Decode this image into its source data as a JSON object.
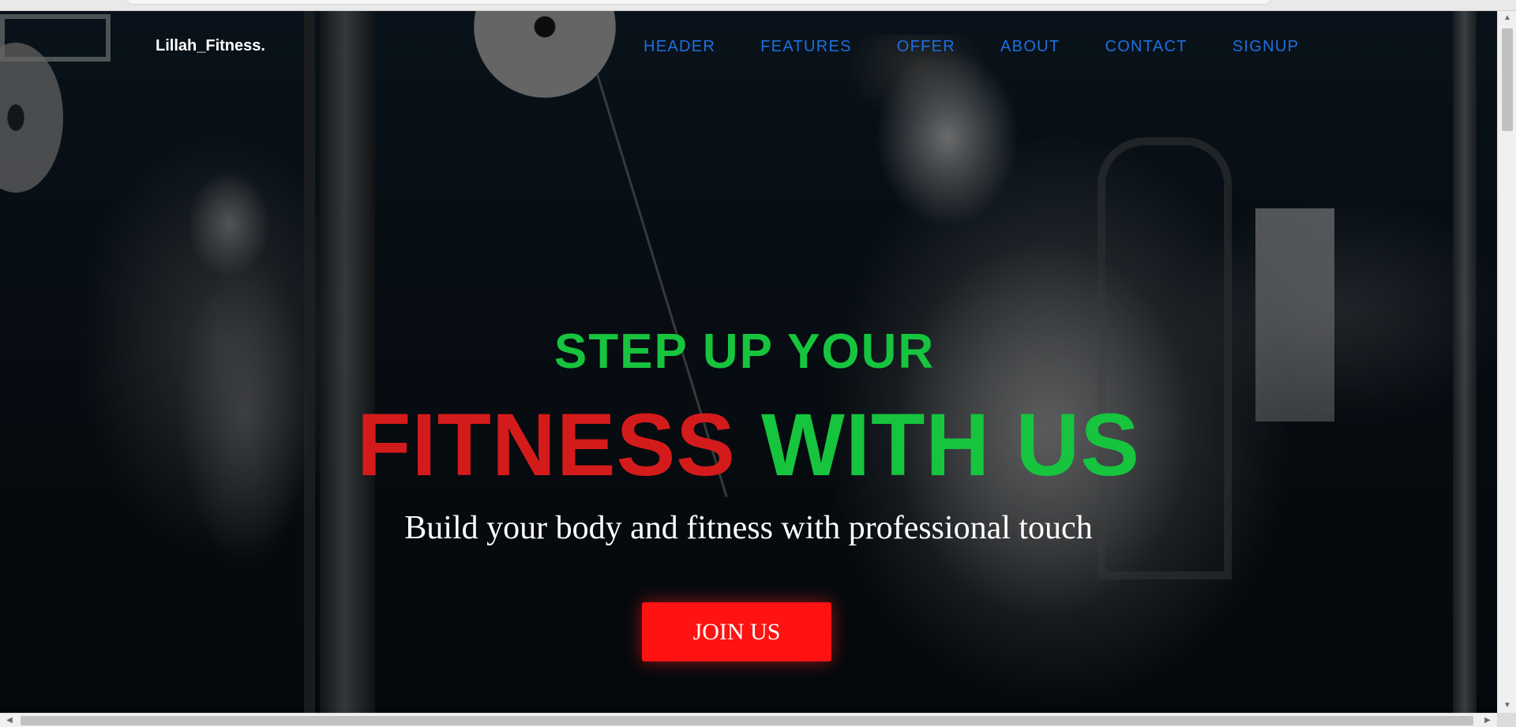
{
  "brand": {
    "name": "Lillah_Fitness."
  },
  "nav": {
    "items": [
      {
        "label": "HEADER"
      },
      {
        "label": "FEATURES"
      },
      {
        "label": "OFFER"
      },
      {
        "label": "ABOUT"
      },
      {
        "label": "CONTACT"
      },
      {
        "label": "SIGNUP"
      }
    ]
  },
  "hero": {
    "line1": "STEP UP YOUR",
    "line2_red": "FITNESS",
    "line2_green": "WITH US",
    "subtitle": "Build your body and fitness with professional touch",
    "cta_label": "JOIN US"
  },
  "colors": {
    "accent_green": "#16c43e",
    "accent_red": "#d41b1b",
    "button_red": "#ff1212",
    "nav_blue": "#1e6fe0"
  },
  "icons": {
    "scroll_up": "▲",
    "scroll_down": "▼",
    "scroll_left": "◀",
    "scroll_right": "▶"
  }
}
